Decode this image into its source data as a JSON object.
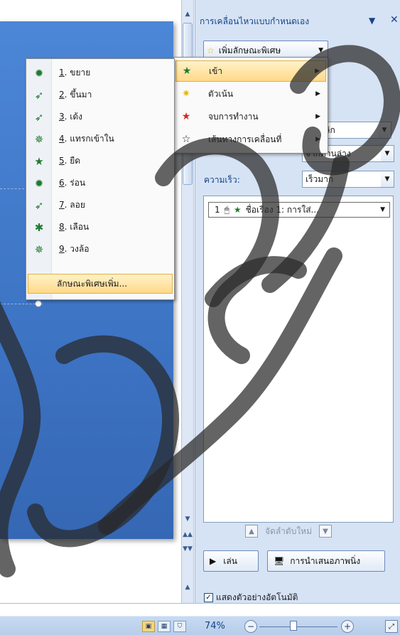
{
  "task_pane": {
    "title": "การเคลื่อนไหวแบบกำหนดเอง",
    "add_effect_label": "เพิ่มลักษณะพิเศษ",
    "start_value": "มื่อคลิก",
    "direction_value": "จากด้านล่าง",
    "speed_label": "ความเร็ว:",
    "speed_value": "เร็วมาก",
    "effect_item": {
      "order": "1",
      "name": "ชื่อเรื่อง 1: การใส่..."
    },
    "reorder_label": "จัดลำดับใหม่",
    "play_label": "เล่น",
    "slideshow_label": "การนำเสนอภาพนิ่ง",
    "autopreview_label": "แสดงตัวอย่างอัตโนมัติ",
    "autopreview_checked": true
  },
  "category_menu": {
    "items": [
      {
        "label": "เข้า",
        "icon": "entrance-star-icon",
        "color": "#1f7a2f",
        "active": true
      },
      {
        "label": "ตัวเน้น",
        "icon": "emphasis-star-icon",
        "color": "#e6b800",
        "active": false
      },
      {
        "label": "จบการทำงาน",
        "icon": "exit-star-icon",
        "color": "#d22a1e",
        "active": false
      },
      {
        "label": "เส้นทางการเคลื่อนที่",
        "icon": "motion-path-star-icon",
        "color": "#555555",
        "active": false
      }
    ]
  },
  "entrance_menu": {
    "items": [
      {
        "num": "1",
        "label": ". ขยาย"
      },
      {
        "num": "2",
        "label": ". ขึ้นมา"
      },
      {
        "num": "3",
        "label": ". เด้ง"
      },
      {
        "num": "4",
        "label": ". แทรกเข้าใน"
      },
      {
        "num": "5",
        "label": ". ยืด"
      },
      {
        "num": "6",
        "label": ". ร่อน"
      },
      {
        "num": "7",
        "label": ". ลอย"
      },
      {
        "num": "8",
        "label": ". เลือน"
      },
      {
        "num": "9",
        "label": ". วงล้อ"
      }
    ],
    "more_label": "ลักษณะพิเศษเพิ่ม..."
  },
  "status_bar": {
    "zoom": "74%"
  },
  "colors": {
    "slide": "#3d74c4",
    "pane_bg": "#d6e3f4",
    "highlight": "#ffd98a"
  }
}
